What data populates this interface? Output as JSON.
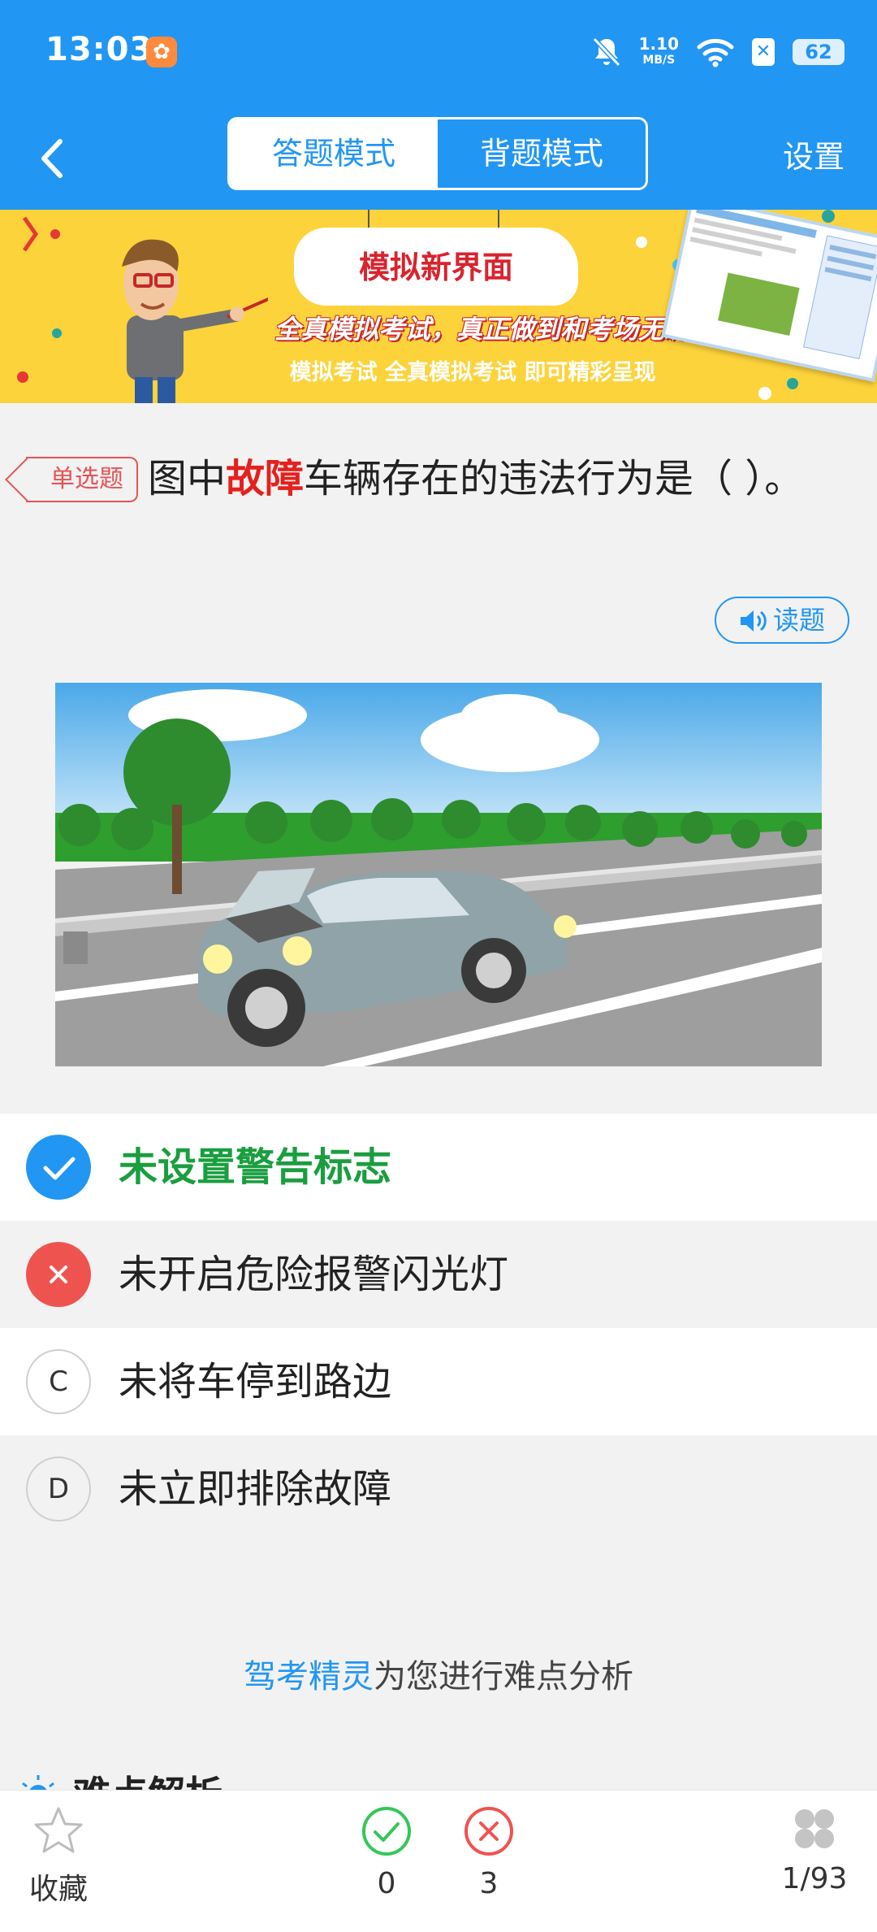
{
  "status_bar": {
    "time": "13:03",
    "net_speed_value": "1.10",
    "net_speed_unit": "MB/S",
    "battery": "62"
  },
  "nav": {
    "mode_answer": "答题模式",
    "mode_memorize": "背题模式",
    "settings": "设置"
  },
  "banner": {
    "title": "模拟新界面",
    "slogan": "全真模拟考试，真正做到和考场无缝对接。",
    "subtitle": "模拟考试 全真模拟考试 即可精彩呈现"
  },
  "question": {
    "type_badge": "单选题",
    "text_before": "图中",
    "text_highlight": "故障",
    "text_after": "车辆存在的违法行为是（ ）。",
    "read_button": "读题"
  },
  "options": [
    {
      "text": "未设置警告标志",
      "state": "correct"
    },
    {
      "text": "未开启危险报警闪光灯",
      "state": "wrong"
    },
    {
      "letter": "C",
      "text": "未将车停到路边",
      "state": "normal"
    },
    {
      "letter": "D",
      "text": "未立即排除故障",
      "state": "normal"
    }
  ],
  "analysis": {
    "brand": "驾考精灵",
    "suffix": "为您进行难点分析",
    "section_title": "难点解析"
  },
  "bottom_bar": {
    "favorite_label": "收藏",
    "correct_count": "0",
    "wrong_count": "3",
    "progress": "1/93"
  },
  "colors": {
    "primary": "#2196f3",
    "banner": "#fdd33b",
    "correct": "#1a9e3f",
    "wrong": "#ef5350",
    "highlight": "#e5201d"
  }
}
